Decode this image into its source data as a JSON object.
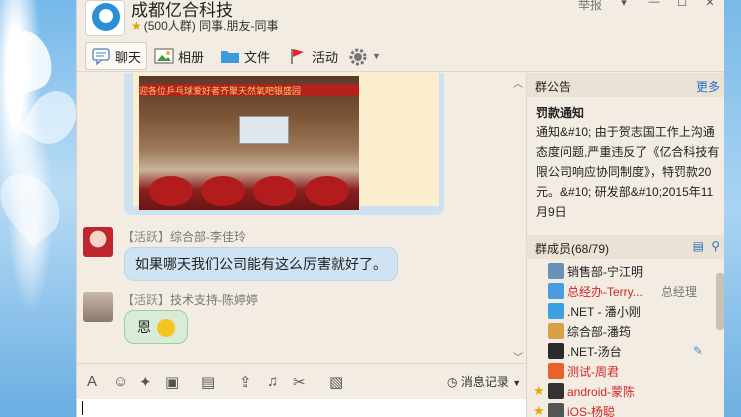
{
  "window": {
    "group_name": "成都亿合科技",
    "group_info": "(500人群) 同事.朋友-同事",
    "report_label": "举报",
    "menu_symbol": "▾",
    "minimize_symbol": "—",
    "maximize_symbol": "☐",
    "close_symbol": "✕"
  },
  "toolbar": {
    "tabs": [
      {
        "label": "聊天",
        "icon": "chat-bubble-icon"
      },
      {
        "label": "相册",
        "icon": "photo-icon"
      },
      {
        "label": "文件",
        "icon": "folder-icon"
      },
      {
        "label": "活动",
        "icon": "flag-icon"
      }
    ],
    "settings_icon": "gear-icon"
  },
  "chat": {
    "photo_banner_text": "迎各位乒乓球爱好者齐聚天然氧吧银盛园",
    "messages": [
      {
        "sender": "综合部-李佳玲",
        "tag": "【活跃】",
        "text": "如果哪天我们公司能有这么厉害就好了。"
      },
      {
        "sender": "技术支持-陈婷婷",
        "tag": "【活跃】",
        "text": "恩"
      }
    ]
  },
  "input_toolbar": {
    "tools": [
      "A",
      "☺",
      "✦",
      "▣",
      "▤",
      "⇪",
      "♫",
      "✂",
      "▧"
    ],
    "history_label": "消息记录"
  },
  "notice": {
    "header": "群公告",
    "more_label": "更多",
    "title": "罚款通知",
    "body": "通知&#10;    由于贺志国工作上沟通态度问题,严重违反了《亿合科技有限公司响应协同制度》，特罚款20元。&#10;          研发部&#10;2015年11月9日"
  },
  "members": {
    "header": "群成员(68/79)",
    "list": [
      {
        "name": "销售部-宁江明",
        "color": "#222",
        "star": false,
        "role": ""
      },
      {
        "name": "总经办-Terry...",
        "color": "#d0282a",
        "star": false,
        "role": "总经理"
      },
      {
        "name": ".NET - 潘小刚",
        "color": "#222",
        "star": false,
        "role": ""
      },
      {
        "name": "综合部-潘筠",
        "color": "#222",
        "star": false,
        "role": ""
      },
      {
        "name": ".NET-汤台",
        "color": "#222",
        "star": false,
        "role": ""
      },
      {
        "name": "测试-周君",
        "color": "#d0282a",
        "star": false,
        "role": ""
      },
      {
        "name": "android-蒙陈",
        "color": "#d0282a",
        "star": true,
        "role": ""
      },
      {
        "name": "iOS-杨聪",
        "color": "#d0282a",
        "star": true,
        "role": ""
      }
    ]
  }
}
